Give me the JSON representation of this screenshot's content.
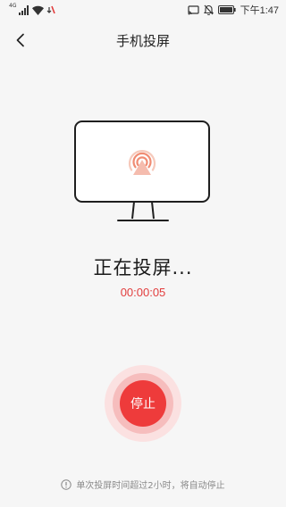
{
  "status_bar": {
    "network_type": "4G",
    "time": "下午1:47",
    "icons": [
      "signal-icon",
      "wifi-icon",
      "data-off-icon",
      "cast-icon",
      "mute-icon",
      "battery-icon"
    ]
  },
  "nav": {
    "back_icon": "chevron-left-icon",
    "title": "手机投屏"
  },
  "illustration": {
    "icon": "screen-cast-icon",
    "accent_color": "#f08c73"
  },
  "cast": {
    "status_text": "正在投屏...",
    "elapsed": "00:00:05"
  },
  "stop_button": {
    "label": "停止",
    "color": "#ee3b3b"
  },
  "footer": {
    "icon": "info-icon",
    "note": "单次投屏时间超过2小时，将自动停止"
  }
}
